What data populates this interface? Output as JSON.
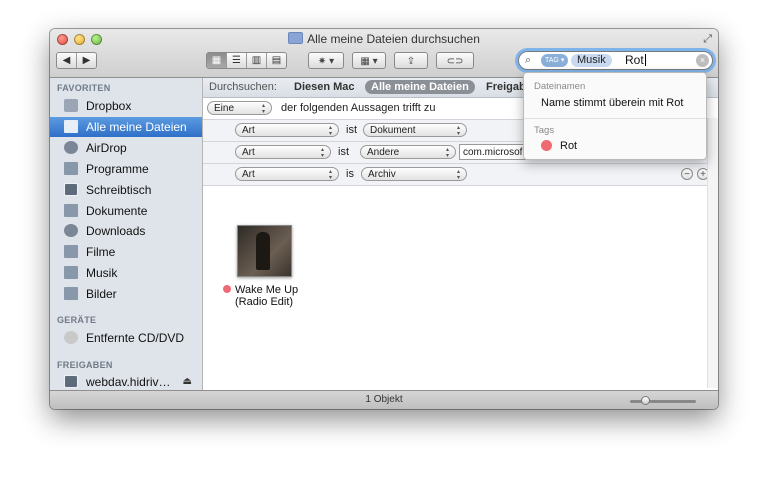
{
  "window": {
    "title": "Alle meine Dateien durchsuchen"
  },
  "toolbar": {
    "nav_back": "◀",
    "nav_forward": "▶",
    "view_icons": [
      "▦",
      "☰",
      "▥",
      "▤"
    ],
    "action": "✷ ▾",
    "arrange": "▦ ▾",
    "share": "⇪",
    "tags": "⊂⊃"
  },
  "search": {
    "token_tag": "TAG",
    "token_value": "Musik",
    "query": "Rot",
    "clear": "×"
  },
  "sidebar": {
    "sections": [
      {
        "header": "FAVORITEN",
        "items": [
          {
            "label": "Dropbox",
            "icon": "folder-icon"
          },
          {
            "label": "Alle meine Dateien",
            "icon": "all-files-icon",
            "selected": true
          },
          {
            "label": "AirDrop",
            "icon": "airdrop-icon"
          },
          {
            "label": "Programme",
            "icon": "applications-icon"
          },
          {
            "label": "Schreibtisch",
            "icon": "desktop-icon"
          },
          {
            "label": "Dokumente",
            "icon": "documents-icon"
          },
          {
            "label": "Downloads",
            "icon": "downloads-icon"
          },
          {
            "label": "Filme",
            "icon": "movies-icon"
          },
          {
            "label": "Musik",
            "icon": "music-icon"
          },
          {
            "label": "Bilder",
            "icon": "pictures-icon"
          }
        ]
      },
      {
        "header": "GERÄTE",
        "items": [
          {
            "label": "Entfernte CD/DVD",
            "icon": "disc-icon"
          }
        ]
      },
      {
        "header": "FREIGABEN",
        "items": [
          {
            "label": "webdav.hidriv…",
            "icon": "server-icon"
          }
        ]
      }
    ]
  },
  "scope": {
    "label": "Durchsuchen:",
    "option_mac": "Diesen Mac",
    "option_all": "Alle meine Dateien",
    "option_shared": "Freigab"
  },
  "criteria": {
    "match_popup": "Eine",
    "match_text": "der folgenden Aussagen trifft zu",
    "rows": [
      {
        "attr": "Art",
        "op": "ist",
        "value": "Dokument"
      },
      {
        "attr": "Art",
        "op": "ist",
        "value": "Andere",
        "text": "com.microsof"
      },
      {
        "attr": "Art",
        "op": "is",
        "value": "Archiv"
      }
    ],
    "minus": "−",
    "plus": "+"
  },
  "file": {
    "name_line1": "Wake Me Up",
    "name_line2": "(Radio Edit)",
    "tag_color": "#ee6b76"
  },
  "status": {
    "count": "1 Objekt"
  },
  "suggestions": {
    "filenames_header": "Dateinamen",
    "filenames_item": "Name stimmt überein mit Rot",
    "tags_header": "Tags",
    "tags_item": "Rot"
  },
  "colors": {
    "selection": "#2f6fc8",
    "sidebar_bg": "#dfe4ea",
    "tag_red": "#f06a72",
    "search_focus": "#7eb4ea"
  }
}
